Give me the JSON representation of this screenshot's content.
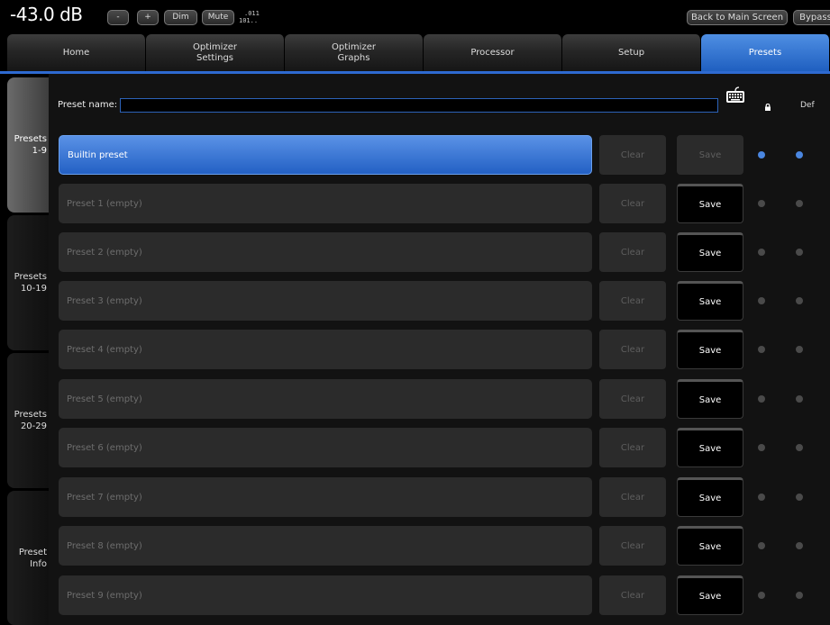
{
  "topbar": {
    "level": "-43.0 dB",
    "minus_label": "-",
    "plus_label": "+",
    "dim_label": "Dim",
    "mute_label": "Mute",
    "bits_line1": ".011",
    "bits_line2": "101..",
    "back_label": "Back to Main Screen",
    "bypass_label": "Bypass"
  },
  "tabs": [
    {
      "label": "Home"
    },
    {
      "label": "Optimizer\nSettings"
    },
    {
      "label": "Optimizer\nGraphs"
    },
    {
      "label": "Processor"
    },
    {
      "label": "Setup"
    },
    {
      "label": "Presets"
    }
  ],
  "sidenav": [
    {
      "label": "Presets\n1-9"
    },
    {
      "label": "Presets\n10-19"
    },
    {
      "label": "Presets\n20-29"
    },
    {
      "label": "Preset\nInfo"
    }
  ],
  "preset_name": {
    "label": "Preset name:",
    "value": "",
    "def_label": "Def"
  },
  "presets": [
    {
      "name": "Builtin preset",
      "clear": "Clear",
      "save": "Save"
    },
    {
      "name": "Preset 1 (empty)",
      "clear": "Clear",
      "save": "Save"
    },
    {
      "name": "Preset 2 (empty)",
      "clear": "Clear",
      "save": "Save"
    },
    {
      "name": "Preset 3 (empty)",
      "clear": "Clear",
      "save": "Save"
    },
    {
      "name": "Preset 4 (empty)",
      "clear": "Clear",
      "save": "Save"
    },
    {
      "name": "Preset 5 (empty)",
      "clear": "Clear",
      "save": "Save"
    },
    {
      "name": "Preset 6 (empty)",
      "clear": "Clear",
      "save": "Save"
    },
    {
      "name": "Preset 7 (empty)",
      "clear": "Clear",
      "save": "Save"
    },
    {
      "name": "Preset 8 (empty)",
      "clear": "Clear",
      "save": "Save"
    },
    {
      "name": "Preset 9 (empty)",
      "clear": "Clear",
      "save": "Save"
    }
  ],
  "colors": {
    "accent": "#2e6ad1",
    "active_field": "#3a78d8",
    "indicator_on": "#4a86e0",
    "indicator_off": "#4a4a4a"
  }
}
